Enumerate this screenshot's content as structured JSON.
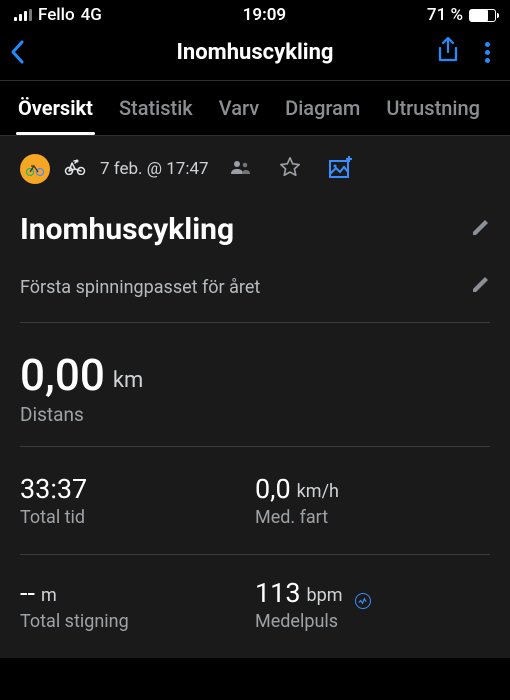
{
  "status_bar": {
    "carrier": "Fello",
    "network": "4G",
    "time": "19:09",
    "battery_text": "71 %",
    "battery_level": 71
  },
  "header": {
    "title": "Inomhuscykling"
  },
  "tabs": {
    "items": [
      {
        "label": "Översikt",
        "active": true
      },
      {
        "label": "Statistik",
        "active": false
      },
      {
        "label": "Varv",
        "active": false
      },
      {
        "label": "Diagram",
        "active": false
      },
      {
        "label": "Utrustning",
        "active": false
      }
    ]
  },
  "activity": {
    "datetime": "7 feb. @ 17:47",
    "title": "Inomhuscykling",
    "description": "Första spinningpasset för året"
  },
  "stats": {
    "distance": {
      "value": "0,00",
      "unit": "km",
      "label": "Distans"
    },
    "total_time": {
      "value": "33:37",
      "label": "Total tid"
    },
    "avg_speed": {
      "value": "0,0",
      "unit": "km/h",
      "label": "Med. fart"
    },
    "total_ascent": {
      "value": "--",
      "unit": "m",
      "label": "Total stigning"
    },
    "avg_hr": {
      "value": "113",
      "unit": "bpm",
      "label": "Medelpuls"
    }
  }
}
